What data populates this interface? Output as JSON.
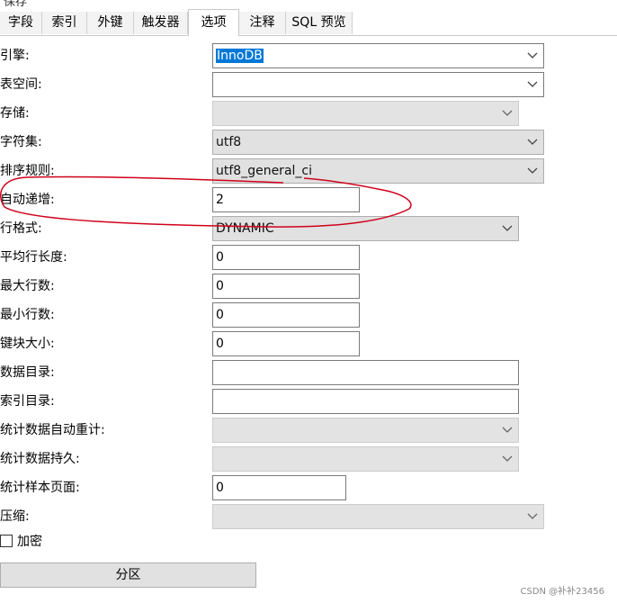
{
  "window": {
    "title": "保存"
  },
  "tabs": [
    {
      "label": "字段"
    },
    {
      "label": "索引"
    },
    {
      "label": "外键"
    },
    {
      "label": "触发器"
    },
    {
      "label": "选项",
      "active": true
    },
    {
      "label": "注释"
    },
    {
      "label": "SQL 预览"
    }
  ],
  "options": {
    "engine": {
      "label": "引擎:",
      "value": "InnoDB"
    },
    "tablespace": {
      "label": "表空间:",
      "value": ""
    },
    "storage": {
      "label": "存储:",
      "value": ""
    },
    "charset": {
      "label": "字符集:",
      "value": "utf8"
    },
    "collation": {
      "label": "排序规则:",
      "value": "utf8_general_ci"
    },
    "auto_increment": {
      "label": "自动递增:",
      "value": "2"
    },
    "row_format": {
      "label": "行格式:",
      "value": "DYNAMIC"
    },
    "avg_row_length": {
      "label": "平均行长度:",
      "value": "0"
    },
    "max_rows": {
      "label": "最大行数:",
      "value": "0"
    },
    "min_rows": {
      "label": "最小行数:",
      "value": "0"
    },
    "key_block_size": {
      "label": "键块大小:",
      "value": "0"
    },
    "data_directory": {
      "label": "数据目录:",
      "value": ""
    },
    "index_directory": {
      "label": "索引目录:",
      "value": ""
    },
    "stats_auto_recalc": {
      "label": "统计数据自动重计:",
      "value": ""
    },
    "stats_persistent": {
      "label": "统计数据持久:",
      "value": ""
    },
    "stats_sample_pages": {
      "label": "统计样本页面:",
      "value": "0"
    },
    "compression": {
      "label": "压缩:",
      "value": ""
    }
  },
  "encryption": {
    "label": "加密",
    "checked": false
  },
  "partition_button": {
    "label": "分区"
  },
  "watermark": "CSDN @补补23456",
  "colors": {
    "selection": "#0078d7",
    "annotation": "#d0021b"
  }
}
